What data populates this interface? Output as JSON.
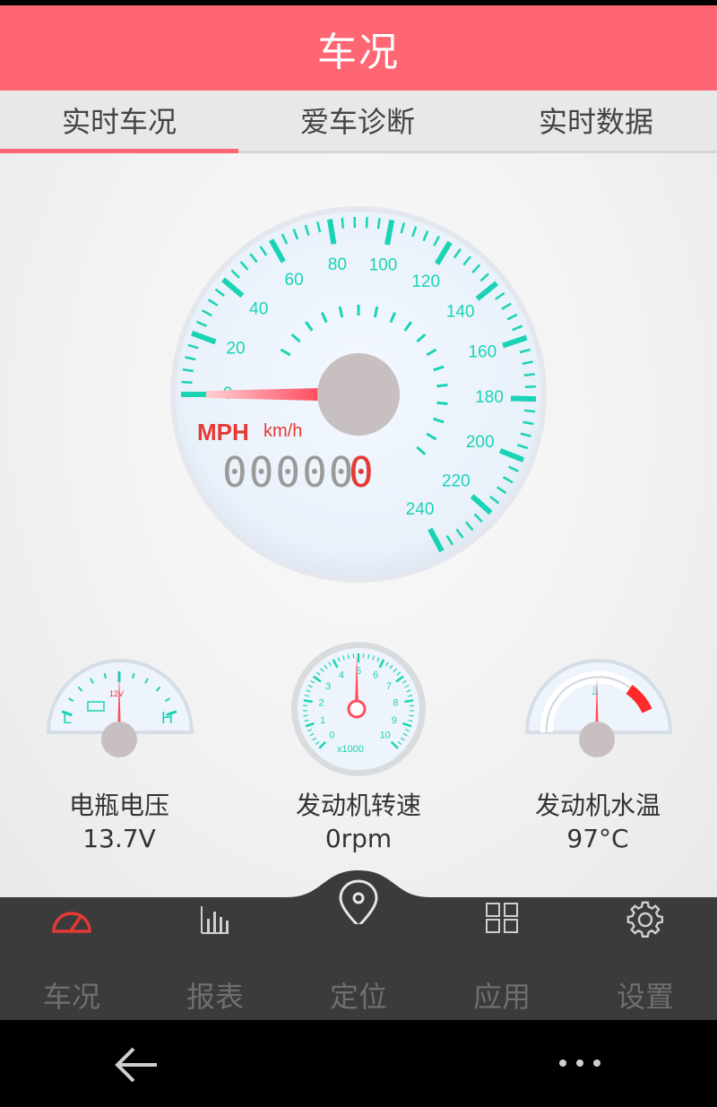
{
  "header": {
    "title": "车况"
  },
  "tabs": [
    {
      "label": "实时车况",
      "active": true
    },
    {
      "label": "爱车诊断",
      "active": false
    },
    {
      "label": "实时数据",
      "active": false
    }
  ],
  "speedometer": {
    "ticks": [
      "0",
      "20",
      "40",
      "60",
      "80",
      "100",
      "120",
      "140",
      "160",
      "180",
      "200",
      "220",
      "240"
    ],
    "unit_primary": "MPH",
    "unit_secondary": "km/h",
    "odometer_grey": "00000",
    "odometer_red": "0",
    "speed_value": 0
  },
  "small_gauges": [
    {
      "name": "电瓶电压",
      "value": "13.7V",
      "low_label": "L",
      "high_label": "H",
      "mark": "12V"
    },
    {
      "name": "发动机转速",
      "value": "0rpm",
      "ticks": [
        "0",
        "1",
        "2",
        "3",
        "4",
        "5",
        "6",
        "7",
        "8",
        "9",
        "10"
      ],
      "multiplier": "x1000"
    },
    {
      "name": "发动机水温",
      "value": "97°C"
    }
  ],
  "bottom_nav": [
    {
      "label": "车况",
      "icon": "speedometer-icon",
      "active": true
    },
    {
      "label": "报表",
      "icon": "bar-chart-icon",
      "active": false
    },
    {
      "label": "定位",
      "icon": "location-pin-icon",
      "active": false
    },
    {
      "label": "应用",
      "icon": "grid-icon",
      "active": false
    },
    {
      "label": "设置",
      "icon": "gear-icon",
      "active": false
    }
  ],
  "colors": {
    "accent": "#fd6672",
    "teal": "#1ad3b5",
    "red": "#e53935"
  }
}
